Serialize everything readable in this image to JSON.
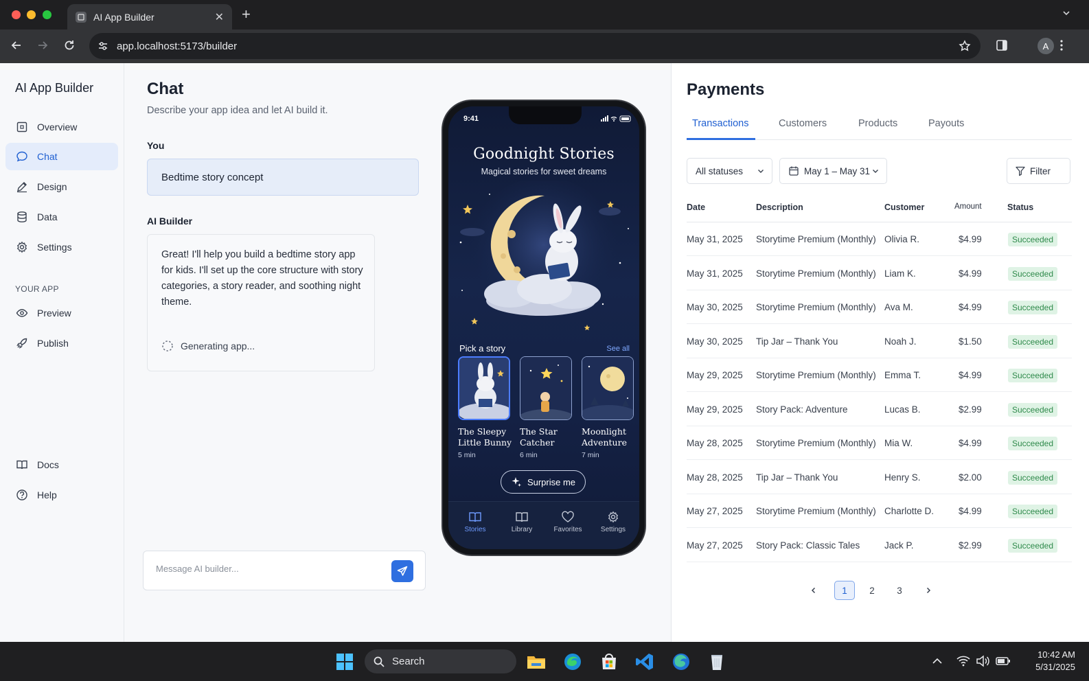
{
  "browser": {
    "tab_title": "AI App Builder",
    "url": "app.localhost:5173/builder",
    "profile_initial": "A"
  },
  "sidebar": {
    "brand": "AI App Builder",
    "items": [
      {
        "label": "Overview",
        "icon": "overview-icon"
      },
      {
        "label": "Chat",
        "icon": "chat-icon",
        "active": true
      },
      {
        "label": "Design",
        "icon": "pen-icon"
      },
      {
        "label": "Data",
        "icon": "database-icon"
      },
      {
        "label": "Settings",
        "icon": "gear-icon"
      }
    ],
    "section_label": "YOUR APP",
    "app_items": [
      {
        "label": "Preview",
        "icon": "eye-icon"
      },
      {
        "label": "Publish",
        "icon": "rocket-icon"
      }
    ],
    "footer_items": [
      {
        "label": "Docs",
        "icon": "book-icon"
      },
      {
        "label": "Help",
        "icon": "help-icon"
      }
    ]
  },
  "chat": {
    "title": "Chat",
    "subtitle": "Describe your app idea and let AI build it.",
    "user_label": "You",
    "user_message": "Bedtime story concept",
    "ai_label": "AI Builder",
    "ai_message": "Great! I'll help you build a bedtime story app for kids. I'll set up the core structure with story categories, a story reader, and soothing night theme.",
    "status": "Generating app...",
    "input_placeholder": "Message AI builder..."
  },
  "phone": {
    "time": "9:41",
    "app_title": "Goodnight Stories",
    "app_subtitle": "Magical stories for sweet dreams",
    "section_title": "Pick a story",
    "see_all": "See all",
    "stories": [
      {
        "title": "The Sleepy Little Bunny",
        "duration": "5 min"
      },
      {
        "title": "The Star Catcher",
        "duration": "6 min"
      },
      {
        "title": "Moonlight Adventure",
        "duration": "7 min"
      }
    ],
    "surprise_label": "Surprise me",
    "tabs": [
      {
        "label": "Stories",
        "icon": "book-open-icon",
        "active": true
      },
      {
        "label": "Library",
        "icon": "library-icon"
      },
      {
        "label": "Favorites",
        "icon": "heart-icon"
      },
      {
        "label": "Settings",
        "icon": "gear-icon"
      }
    ]
  },
  "payments": {
    "title": "Payments",
    "tabs": [
      "Transactions",
      "Customers",
      "Products",
      "Payouts"
    ],
    "active_tab": "Transactions",
    "status_filter": "All statuses",
    "date_range": "May 1 – May 31",
    "filter_label": "Filter",
    "columns": [
      "Date",
      "Description",
      "Customer",
      "Amount",
      "Status"
    ],
    "rows": [
      {
        "date": "May 31, 2025",
        "description": "Storytime Premium (Monthly)",
        "customer": "Olivia R.",
        "amount": "$4.99",
        "status": "Succeeded"
      },
      {
        "date": "May 31, 2025",
        "description": "Storytime Premium (Monthly)",
        "customer": "Liam K.",
        "amount": "$4.99",
        "status": "Succeeded"
      },
      {
        "date": "May 30, 2025",
        "description": "Storytime Premium (Monthly)",
        "customer": "Ava M.",
        "amount": "$4.99",
        "status": "Succeeded"
      },
      {
        "date": "May 30, 2025",
        "description": "Tip Jar – Thank You",
        "customer": "Noah J.",
        "amount": "$1.50",
        "status": "Succeeded"
      },
      {
        "date": "May 29, 2025",
        "description": "Storytime Premium (Monthly)",
        "customer": "Emma T.",
        "amount": "$4.99",
        "status": "Succeeded"
      },
      {
        "date": "May 29, 2025",
        "description": "Story Pack: Adventure",
        "customer": "Lucas B.",
        "amount": "$2.99",
        "status": "Succeeded"
      },
      {
        "date": "May 28, 2025",
        "description": "Storytime Premium (Monthly)",
        "customer": "Mia W.",
        "amount": "$4.99",
        "status": "Succeeded"
      },
      {
        "date": "May 28, 2025",
        "description": "Tip Jar – Thank You",
        "customer": "Henry S.",
        "amount": "$2.00",
        "status": "Succeeded"
      },
      {
        "date": "May 27, 2025",
        "description": "Storytime Premium (Monthly)",
        "customer": "Charlotte D.",
        "amount": "$4.99",
        "status": "Succeeded"
      },
      {
        "date": "May 27, 2025",
        "description": "Story Pack: Classic Tales",
        "customer": "Jack P.",
        "amount": "$2.99",
        "status": "Succeeded"
      }
    ],
    "pages": [
      "1",
      "2",
      "3"
    ],
    "current_page": "1"
  },
  "taskbar": {
    "search_label": "Search",
    "time": "10:42 AM",
    "date": "5/31/2025"
  },
  "colors": {
    "accent": "#2f6fe0",
    "success_bg": "#dff3e5",
    "success_text": "#2f8a4b",
    "app_night": "#16254a"
  }
}
